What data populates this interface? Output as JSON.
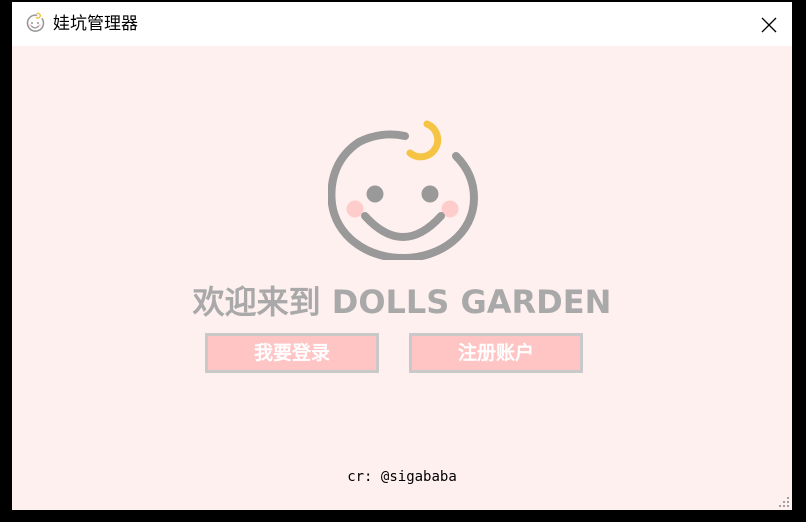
{
  "window": {
    "title": "娃坑管理器"
  },
  "main": {
    "welcome": "欢迎来到 DOLLS GARDEN",
    "login_button": "我要登录",
    "register_button": "注册账户",
    "credit": "cr: @sigababa"
  },
  "icons": {
    "app": "baby-face-icon",
    "close": "close-icon",
    "mascot": "baby-face-logo",
    "resize": "resize-grip-icon"
  },
  "colors": {
    "background": "#fff0f0",
    "titlebar": "#ffffff",
    "button_fill": "#ffc4c4",
    "button_border": "#c9c9c9",
    "welcome_text": "#a9a9a9",
    "mascot_line": "#999999",
    "mascot_accent": "#f5c444",
    "cheeks": "#ffcccc"
  }
}
